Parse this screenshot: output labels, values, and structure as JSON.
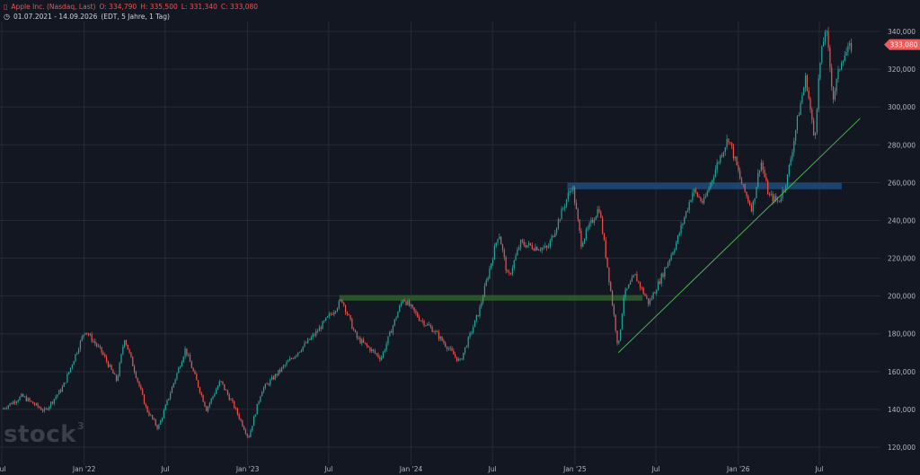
{
  "header": {
    "symbol_icon": "candlestick-icon",
    "instrument": "Apple Inc. (Nasdaq, Last)",
    "open": "O: 334,790",
    "high": "H: 335,500",
    "low": "L: 331,340",
    "close": "C: 333,080",
    "range_icon": "clock-icon",
    "range": "01.07.2021 - 14.09.2026",
    "range_info": "(EDT, 5 Jahre, 1 Tag)"
  },
  "logo": {
    "text": "stock",
    "superscript": "3"
  },
  "colors": {
    "background": "#131722",
    "up": "#26a69a",
    "down": "#ef5350",
    "grid": "#262a35",
    "axis_text": "#b2b5be",
    "trendline": "#4caf50",
    "blue_zone": "#1e4976",
    "green_zone": "#2e5a2e",
    "last_price": "#f05a5a"
  },
  "chart_data": {
    "type": "candlestick",
    "x_ticks": [
      "Jul",
      "Jan '22",
      "Jul",
      "Jan '23",
      "Jul",
      "Jan '24",
      "Jul",
      "Jan '25",
      "Jul",
      "Jan '26",
      "Jul"
    ],
    "x_tick_dates": [
      "2021-07-01",
      "2022-01-01",
      "2022-07-01",
      "2023-01-01",
      "2023-07-01",
      "2024-01-01",
      "2024-07-01",
      "2025-01-01",
      "2025-07-01",
      "2026-01-01",
      "2026-07-01"
    ],
    "y_ticks": [
      "120,000",
      "140,000",
      "160,000",
      "180,000",
      "200,000",
      "220,000",
      "240,000",
      "260,000",
      "280,000",
      "300,000",
      "320,000",
      "340,000"
    ],
    "y_tick_values": [
      120,
      140,
      160,
      180,
      200,
      220,
      240,
      260,
      280,
      300,
      320,
      340
    ],
    "ylim": [
      115,
      350
    ],
    "last_price_label": "333,080",
    "last_price": 333.08,
    "price_path": [
      [
        "2021-07-01",
        140
      ],
      [
        "2021-08-15",
        147
      ],
      [
        "2021-10-05",
        139
      ],
      [
        "2021-11-15",
        152
      ],
      [
        "2022-01-03",
        182
      ],
      [
        "2022-02-10",
        170
      ],
      [
        "2022-03-15",
        155
      ],
      [
        "2022-04-01",
        178
      ],
      [
        "2022-05-20",
        140
      ],
      [
        "2022-06-15",
        130
      ],
      [
        "2022-08-15",
        172
      ],
      [
        "2022-10-01",
        140
      ],
      [
        "2022-11-01",
        155
      ],
      [
        "2022-12-01",
        142
      ],
      [
        "2023-01-03",
        125
      ],
      [
        "2023-02-01",
        150
      ],
      [
        "2023-04-01",
        165
      ],
      [
        "2023-06-01",
        180
      ],
      [
        "2023-07-31",
        198
      ],
      [
        "2023-09-01",
        178
      ],
      [
        "2023-10-26",
        167
      ],
      [
        "2023-12-14",
        199
      ],
      [
        "2024-01-20",
        188
      ],
      [
        "2024-02-20",
        182
      ],
      [
        "2024-04-19",
        165
      ],
      [
        "2024-06-01",
        192
      ],
      [
        "2024-07-15",
        234
      ],
      [
        "2024-08-05",
        209
      ],
      [
        "2024-09-01",
        228
      ],
      [
        "2024-10-01",
        226
      ],
      [
        "2024-11-01",
        225
      ],
      [
        "2024-12-26",
        259
      ],
      [
        "2025-01-15",
        228
      ],
      [
        "2025-02-24",
        247
      ],
      [
        "2025-03-15",
        215
      ],
      [
        "2025-04-08",
        172
      ],
      [
        "2025-04-20",
        200
      ],
      [
        "2025-05-15",
        211
      ],
      [
        "2025-06-15",
        196
      ],
      [
        "2025-07-15",
        211
      ],
      [
        "2025-08-15",
        228
      ],
      [
        "2025-09-22",
        256
      ],
      [
        "2025-10-15",
        249
      ],
      [
        "2025-11-15",
        270
      ],
      [
        "2025-12-10",
        284
      ],
      [
        "2026-01-10",
        258
      ],
      [
        "2026-02-01",
        246
      ],
      [
        "2026-02-20",
        272
      ],
      [
        "2026-03-10",
        253
      ],
      [
        "2026-04-01",
        250
      ],
      [
        "2026-04-20",
        262
      ],
      [
        "2026-05-15",
        296
      ],
      [
        "2026-06-01",
        316
      ],
      [
        "2026-06-20",
        282
      ],
      [
        "2026-07-01",
        320
      ],
      [
        "2026-07-15",
        343
      ],
      [
        "2026-08-01",
        305
      ],
      [
        "2026-08-20",
        326
      ],
      [
        "2026-09-14",
        333
      ]
    ],
    "annotations": {
      "green_zone": {
        "from": "2023-07-25",
        "to": "2025-06-01",
        "low": 197.5,
        "high": 200.5
      },
      "blue_zone": {
        "from": "2024-12-15",
        "to": "2026-08-20",
        "low": 256.5,
        "high": 260
      },
      "trendline": {
        "from": [
          "2025-04-08",
          170
        ],
        "to": [
          "2026-09-30",
          294
        ]
      }
    }
  }
}
